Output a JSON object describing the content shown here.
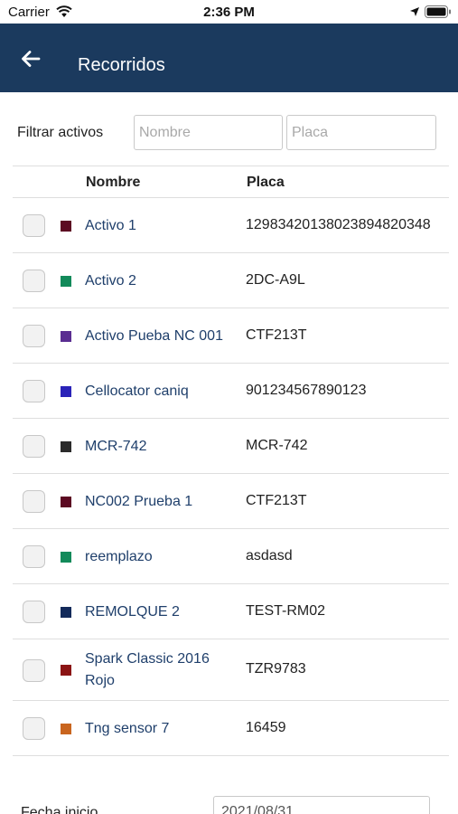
{
  "status_bar": {
    "carrier": "Carrier",
    "time": "2:36 PM"
  },
  "nav": {
    "title": "Recorridos"
  },
  "filter": {
    "label": "Filtrar activos",
    "name_placeholder": "Nombre",
    "plate_placeholder": "Placa"
  },
  "table": {
    "headers": {
      "name": "Nombre",
      "plate": "Placa"
    },
    "rows": [
      {
        "name": "Activo 1",
        "plate": "12983420138023894820348",
        "color": "#5c0a22",
        "checked": false
      },
      {
        "name": "Activo 2",
        "plate": "2DC-A9L",
        "color": "#128a5a",
        "checked": false
      },
      {
        "name": "Activo Pueba NC 001",
        "plate": "CTF213T",
        "color": "#5a2d91",
        "checked": false
      },
      {
        "name": "Cellocator caniq",
        "plate": "901234567890123",
        "color": "#2a23b8",
        "checked": false
      },
      {
        "name": "MCR-742",
        "plate": "MCR-742",
        "color": "#2b2b2b",
        "checked": false
      },
      {
        "name": "NC002 Prueba 1",
        "plate": "CTF213T",
        "color": "#5c0a22",
        "checked": false
      },
      {
        "name": "reemplazo",
        "plate": "asdasd",
        "color": "#128a5a",
        "checked": false
      },
      {
        "name": "REMOLQUE 2",
        "plate": "TEST-RM02",
        "color": "#132a5a",
        "checked": false
      },
      {
        "name": "Spark Classic 2016 Rojo",
        "plate": "TZR9783",
        "color": "#8b1414",
        "checked": false
      },
      {
        "name": "Tng sensor 7",
        "plate": "16459",
        "color": "#c9651f",
        "checked": false
      }
    ]
  },
  "date_filter": {
    "label": "Fecha inicio",
    "value": "2021/08/31"
  },
  "colors": {
    "nav_background": "#1b3a5e",
    "link": "#1f3f6b"
  }
}
